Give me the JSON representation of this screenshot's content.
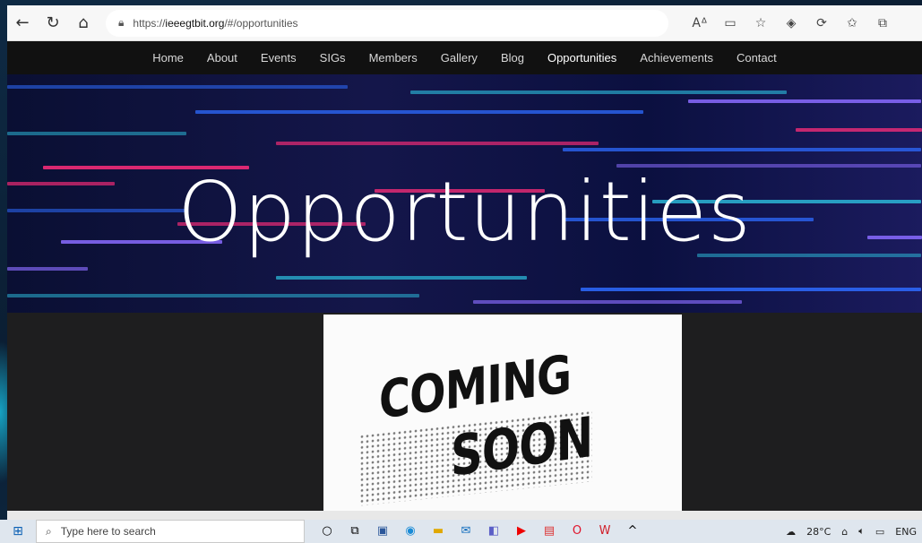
{
  "browser": {
    "url_prefix": "https://",
    "url_host": "ieeegtbit.org",
    "url_path": "/#/opportunities",
    "nav_icons": {
      "back": "back-arrow-icon",
      "refresh": "refresh-icon",
      "home": "home-icon"
    },
    "toolbar_icons": [
      "read-aloud-icon",
      "immersive-reader-icon",
      "add-favorite-icon",
      "extensions-icon",
      "copilot-icon",
      "favorites-icon",
      "collections-icon"
    ]
  },
  "site": {
    "nav": [
      {
        "label": "Home",
        "active": false
      },
      {
        "label": "About",
        "active": false
      },
      {
        "label": "Events",
        "active": false
      },
      {
        "label": "SIGs",
        "active": false
      },
      {
        "label": "Members",
        "active": false
      },
      {
        "label": "Gallery",
        "active": false
      },
      {
        "label": "Blog",
        "active": false
      },
      {
        "label": "Opportunities",
        "active": true
      },
      {
        "label": "Achievements",
        "active": false
      },
      {
        "label": "Contact",
        "active": false
      }
    ],
    "hero_title": "Opportunities",
    "poster": {
      "line1": "COMING",
      "line2": "SOON"
    }
  },
  "taskbar": {
    "search_placeholder": "Type here to search",
    "temperature": "28°C",
    "language": "ENG"
  },
  "colors": {
    "hero_pink": "#ff2d7a",
    "hero_blue": "#2e6bff",
    "hero_cyan": "#2bb6d6",
    "hero_violet": "#8a6bff"
  }
}
